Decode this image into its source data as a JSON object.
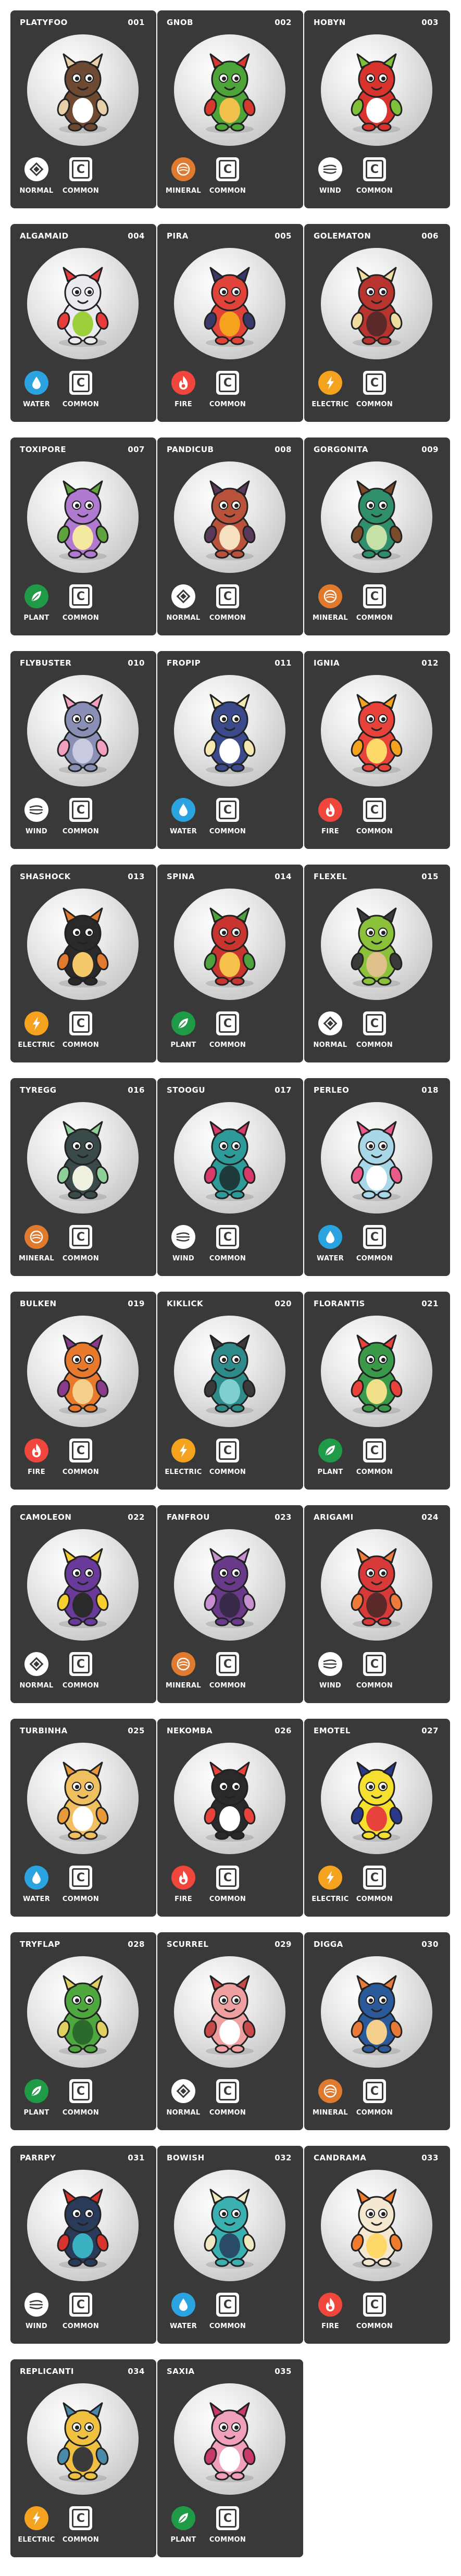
{
  "colors": {
    "card": "#393939",
    "normal": "#ffffff",
    "mineral": "#e07a2e",
    "wind": "#ffffff",
    "water": "#2aa3e0",
    "fire": "#f0463b",
    "electric": "#f5a21e",
    "plant": "#1f9a46"
  },
  "cards": [
    {
      "name": "PLATYFOO",
      "number": "001",
      "type": "NORMAL",
      "type_icon": "diamond-icon",
      "rarity": "COMMON",
      "rarity_letter": "C",
      "art": "platypus-creature"
    },
    {
      "name": "GNOB",
      "number": "002",
      "type": "MINERAL",
      "type_icon": "rock-icon",
      "rarity": "COMMON",
      "rarity_letter": "C",
      "art": "green-red-goblin"
    },
    {
      "name": "HOBYN",
      "number": "003",
      "type": "WIND",
      "type_icon": "wind-icon",
      "rarity": "COMMON",
      "rarity_letter": "C",
      "art": "red-leaf-bird"
    },
    {
      "name": "ALGAMAID",
      "number": "004",
      "type": "WATER",
      "type_icon": "water-drop-icon",
      "rarity": "COMMON",
      "rarity_letter": "C",
      "art": "seaweed-ghost"
    },
    {
      "name": "PIRA",
      "number": "005",
      "type": "FIRE",
      "type_icon": "flame-icon",
      "rarity": "COMMON",
      "rarity_letter": "C",
      "art": "flame-haired-creature"
    },
    {
      "name": "GOLEMATON",
      "number": "006",
      "type": "ELECTRIC",
      "type_icon": "bolt-icon",
      "rarity": "COMMON",
      "rarity_letter": "C",
      "art": "red-golem"
    },
    {
      "name": "TOXIPORE",
      "number": "007",
      "type": "PLANT",
      "type_icon": "leaf-icon",
      "rarity": "COMMON",
      "rarity_letter": "C",
      "art": "purple-mushroom"
    },
    {
      "name": "PANDICUB",
      "number": "008",
      "type": "NORMAL",
      "type_icon": "diamond-icon",
      "rarity": "COMMON",
      "rarity_letter": "C",
      "art": "red-panda-cub"
    },
    {
      "name": "GORGONITA",
      "number": "009",
      "type": "MINERAL",
      "type_icon": "rock-icon",
      "rarity": "COMMON",
      "rarity_letter": "C",
      "art": "green-snake-hair"
    },
    {
      "name": "FLYBUSTER",
      "number": "010",
      "type": "WIND",
      "type_icon": "wind-icon",
      "rarity": "COMMON",
      "rarity_letter": "C",
      "art": "grey-fly"
    },
    {
      "name": "FROPIP",
      "number": "011",
      "type": "WATER",
      "type_icon": "water-drop-icon",
      "rarity": "COMMON",
      "rarity_letter": "C",
      "art": "penguin-chick"
    },
    {
      "name": "IGNIA",
      "number": "012",
      "type": "FIRE",
      "type_icon": "flame-icon",
      "rarity": "COMMON",
      "rarity_letter": "C",
      "art": "flame-spirit"
    },
    {
      "name": "SHASHOCK",
      "number": "013",
      "type": "ELECTRIC",
      "type_icon": "bolt-icon",
      "rarity": "COMMON",
      "rarity_letter": "C",
      "art": "black-orange-pup"
    },
    {
      "name": "SPINA",
      "number": "014",
      "type": "PLANT",
      "type_icon": "leaf-icon",
      "rarity": "COMMON",
      "rarity_letter": "C",
      "art": "red-thorn-plant"
    },
    {
      "name": "FLEXEL",
      "number": "015",
      "type": "NORMAL",
      "type_icon": "diamond-icon",
      "rarity": "COMMON",
      "rarity_letter": "C",
      "art": "green-fighter"
    },
    {
      "name": "TYREGG",
      "number": "016",
      "type": "MINERAL",
      "type_icon": "rock-icon",
      "rarity": "COMMON",
      "rarity_letter": "C",
      "art": "eggshell-dino"
    },
    {
      "name": "STOOGU",
      "number": "017",
      "type": "WIND",
      "type_icon": "wind-icon",
      "rarity": "COMMON",
      "rarity_letter": "C",
      "art": "teal-bat"
    },
    {
      "name": "PERLEO",
      "number": "018",
      "type": "WATER",
      "type_icon": "water-drop-icon",
      "rarity": "COMMON",
      "rarity_letter": "C",
      "art": "pearl-shell-cat"
    },
    {
      "name": "BULKEN",
      "number": "019",
      "type": "FIRE",
      "type_icon": "flame-icon",
      "rarity": "COMMON",
      "rarity_letter": "C",
      "art": "orange-ox"
    },
    {
      "name": "KIKLICK",
      "number": "020",
      "type": "ELECTRIC",
      "type_icon": "bolt-icon",
      "rarity": "COMMON",
      "rarity_letter": "C",
      "art": "teal-robot"
    },
    {
      "name": "FLORANTIS",
      "number": "021",
      "type": "PLANT",
      "type_icon": "leaf-icon",
      "rarity": "COMMON",
      "rarity_letter": "C",
      "art": "green-mantis"
    },
    {
      "name": "CAMOLEON",
      "number": "022",
      "type": "NORMAL",
      "type_icon": "diamond-icon",
      "rarity": "COMMON",
      "rarity_letter": "C",
      "art": "purple-chameleon"
    },
    {
      "name": "FANFROU",
      "number": "023",
      "type": "MINERAL",
      "type_icon": "rock-icon",
      "rarity": "COMMON",
      "rarity_letter": "C",
      "art": "purple-bat-beast"
    },
    {
      "name": "ARIGAMI",
      "number": "024",
      "type": "WIND",
      "type_icon": "wind-icon",
      "rarity": "COMMON",
      "rarity_letter": "C",
      "art": "red-origami-bird"
    },
    {
      "name": "TURBINHA",
      "number": "025",
      "type": "WATER",
      "type_icon": "water-drop-icon",
      "rarity": "COMMON",
      "rarity_letter": "C",
      "art": "yellow-fish"
    },
    {
      "name": "NEKOMBA",
      "number": "026",
      "type": "FIRE",
      "type_icon": "flame-icon",
      "rarity": "COMMON",
      "rarity_letter": "C",
      "art": "bomb-cat"
    },
    {
      "name": "EMOTEL",
      "number": "027",
      "type": "ELECTRIC",
      "type_icon": "bolt-icon",
      "rarity": "COMMON",
      "rarity_letter": "C",
      "art": "screen-head-robot"
    },
    {
      "name": "TRYFLAP",
      "number": "028",
      "type": "PLANT",
      "type_icon": "leaf-icon",
      "rarity": "COMMON",
      "rarity_letter": "C",
      "art": "green-plant-lizard"
    },
    {
      "name": "SCURREL",
      "number": "029",
      "type": "NORMAL",
      "type_icon": "diamond-icon",
      "rarity": "COMMON",
      "rarity_letter": "C",
      "art": "pink-squirrel"
    },
    {
      "name": "DIGGA",
      "number": "030",
      "type": "MINERAL",
      "type_icon": "rock-icon",
      "rarity": "COMMON",
      "rarity_letter": "C",
      "art": "blue-miner"
    },
    {
      "name": "PARRPY",
      "number": "031",
      "type": "WIND",
      "type_icon": "wind-icon",
      "rarity": "COMMON",
      "rarity_letter": "C",
      "art": "dark-parrot"
    },
    {
      "name": "BOWISH",
      "number": "032",
      "type": "WATER",
      "type_icon": "water-drop-icon",
      "rarity": "COMMON",
      "rarity_letter": "C",
      "art": "bow-fish"
    },
    {
      "name": "CANDRAMA",
      "number": "033",
      "type": "FIRE",
      "type_icon": "flame-icon",
      "rarity": "COMMON",
      "rarity_letter": "C",
      "art": "candle-ghost"
    },
    {
      "name": "REPLICANTI",
      "number": "034",
      "type": "ELECTRIC",
      "type_icon": "bolt-icon",
      "rarity": "COMMON",
      "rarity_letter": "C",
      "art": "yellow-robot-fox"
    },
    {
      "name": "SAXIA",
      "number": "035",
      "type": "PLANT",
      "type_icon": "leaf-icon",
      "rarity": "COMMON",
      "rarity_letter": "C",
      "art": "pink-flower-dancer"
    }
  ]
}
